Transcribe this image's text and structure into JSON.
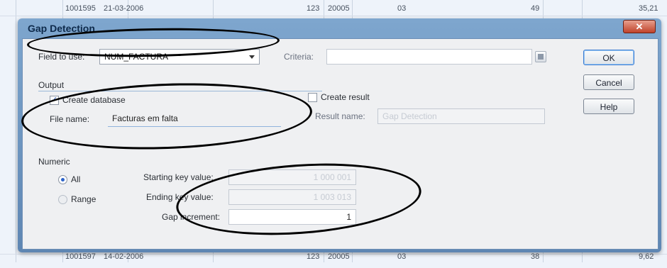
{
  "background": {
    "top_row": {
      "c1": "1001595",
      "c2": "21-03-2006",
      "c3": "123",
      "c4": "20005",
      "c5": "03",
      "c6": "49",
      "c7": "35,21"
    },
    "bottom_row": {
      "c1": "1001597",
      "c2": "14-02-2006",
      "c3": "123",
      "c4": "20005",
      "c5": "03",
      "c6": "38",
      "c7": "9,62"
    }
  },
  "dialog": {
    "title": "Gap Detection",
    "close_glyph": "✕",
    "field_label": "Field to use:",
    "field_value": "NUM_FACTURA",
    "criteria_label": "Criteria:",
    "criteria_value": "",
    "criteria_icon": "calculator-icon",
    "output_label": "Output",
    "create_database_label": "Create database",
    "create_database_checked": true,
    "create_result_label": "Create result",
    "create_result_checked": false,
    "file_name_label": "File name:",
    "file_name_value": "Facturas em falta",
    "result_name_label": "Result name:",
    "result_name_value": "Gap Detection",
    "numeric_label": "Numeric",
    "all_label": "All",
    "range_label": "Range",
    "selected_mode": "All",
    "starting_key_label": "Starting key value:",
    "starting_key_value": "1 000 001",
    "ending_key_label": "Ending key value:",
    "ending_key_value": "1 003 013",
    "gap_increment_label": "Gap increment:",
    "gap_increment_value": "1",
    "buttons": {
      "ok": "OK",
      "cancel": "Cancel",
      "help": "Help"
    }
  },
  "colors": {
    "annotation_ellipse": "#000000",
    "title_bar": "#7ea6ce",
    "close_button": "#c0432b",
    "client_background": "#eff0f2"
  }
}
